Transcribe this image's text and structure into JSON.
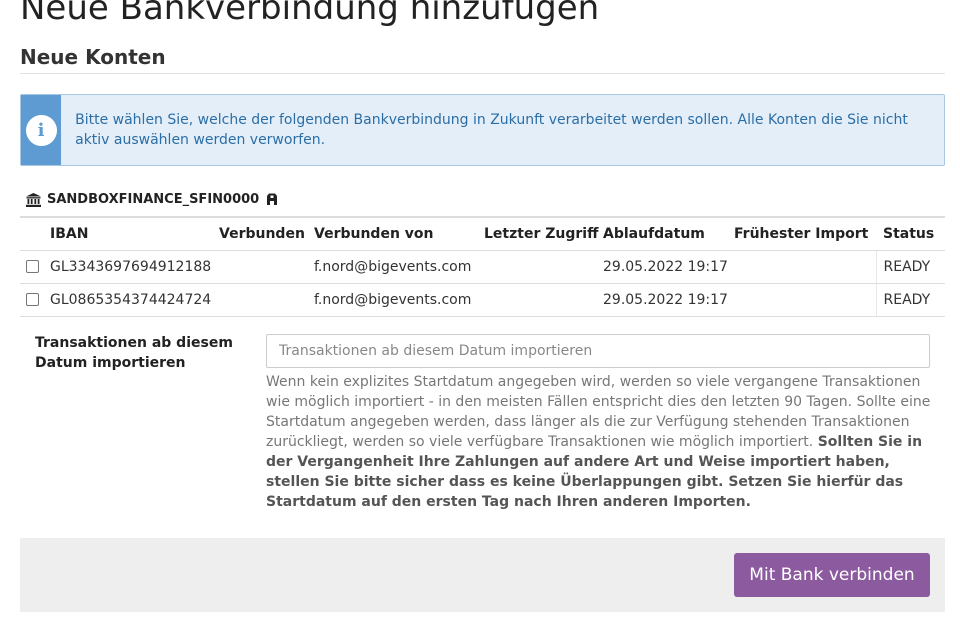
{
  "page": {
    "title": "Neue Bankverbindung hinzufügen",
    "section_title": "Neue Konten"
  },
  "info": {
    "text": "Bitte wählen Sie, welche der folgenden Bankverbindung in Zukunft verarbeitet werden sollen. Alle Konten die Sie nicht aktiv auswählen werden verworfen.",
    "icon": "info-icon"
  },
  "bank": {
    "name": "SANDBOXFINANCE_SFIN0000",
    "icon": "bank-icon",
    "badge_icon": "lock-icon"
  },
  "table": {
    "headers": {
      "iban": "IBAN",
      "verbunden": "Verbunden",
      "verbunden_von": "Verbunden von",
      "letzter_zugriff": "Letzter Zugriff",
      "ablaufdatum": "Ablaufdatum",
      "fruehester_import": "Frühester Import",
      "status": "Status"
    },
    "rows": [
      {
        "checked": false,
        "iban": "GL3343697694912188",
        "verbunden": "",
        "verbunden_von": "f.nord@bigevents.com",
        "letzter_zugriff": "",
        "ablaufdatum": "29.05.2022 19:17",
        "fruehester_import": "",
        "status": "READY"
      },
      {
        "checked": false,
        "iban": "GL0865354374424724",
        "verbunden": "",
        "verbunden_von": "f.nord@bigevents.com",
        "letzter_zugriff": "",
        "ablaufdatum": "29.05.2022 19:17",
        "fruehester_import": "",
        "status": "READY"
      }
    ]
  },
  "form": {
    "label": "Transaktionen ab diesem Datum importieren",
    "input_value": "",
    "input_placeholder": "Transaktionen ab diesem Datum importieren",
    "help_text": "Wenn kein explizites Startdatum angegeben wird, werden so viele vergangene Transaktionen wie möglich importiert - in den meisten Fällen entspricht dies den letzten 90 Tagen. Sollte eine Startdatum angegeben werden, dass länger als die zur Verfügung stehenden Transaktionen zurückliegt, werden so viele verfügbare Transaktionen wie möglich importiert.",
    "help_text_bold": "Sollten Sie in der Vergangenheit Ihre Zahlungen auf andere Art und Weise importiert haben, stellen Sie bitte sicher dass es keine Überlappungen gibt. Setzen Sie hierfür das Startdatum auf den ersten Tag nach Ihren anderen Importen."
  },
  "footer": {
    "connect_label": "Mit Bank verbinden"
  },
  "colors": {
    "info_accent": "#5d9bd2",
    "info_background": "#e3eef8",
    "info_text": "#2b6ea6",
    "primary_button": "#8c5a9e",
    "footer_background": "#eeeeee"
  }
}
